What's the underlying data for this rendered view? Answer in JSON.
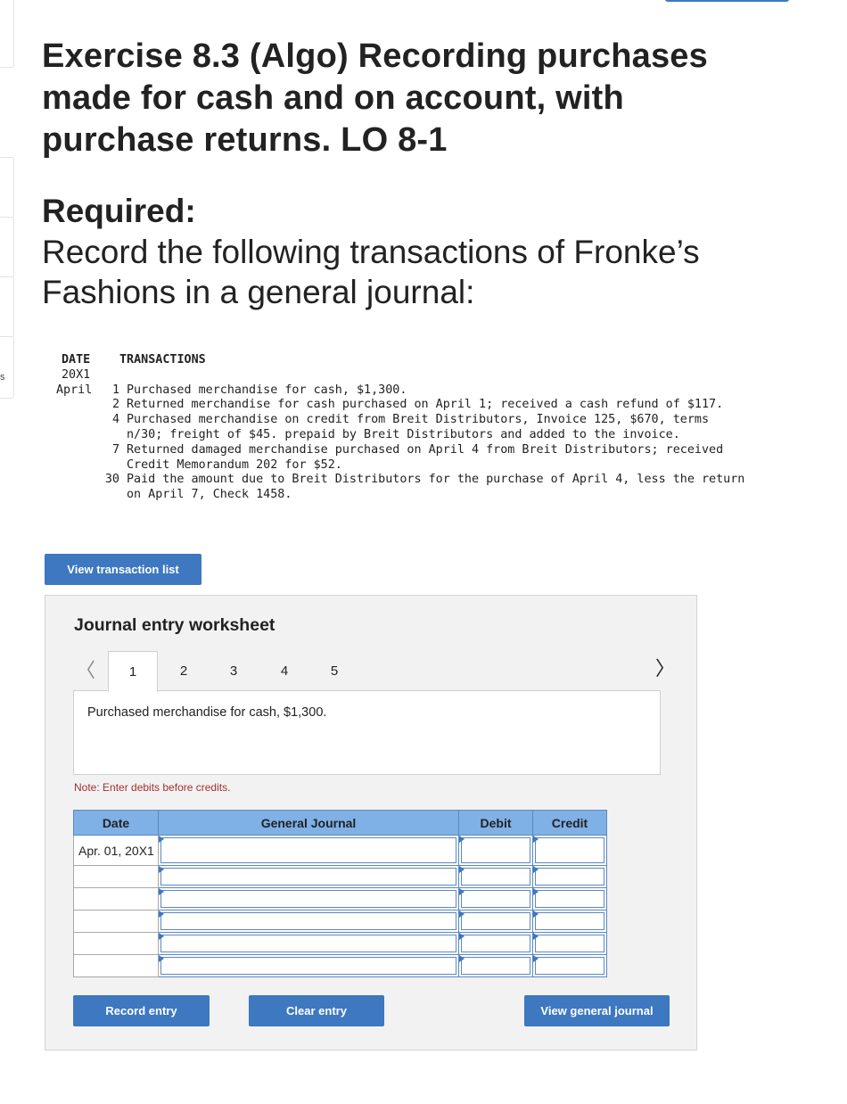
{
  "side_letter": "s",
  "title": "Exercise 8.3 (Algo) Recording purchases made for cash and on account, with purchase returns. LO 8-1",
  "required_label": "Required:",
  "instruction": "Record the following transactions of Fronke’s Fashions in a general journal:",
  "transactions": {
    "header_date": "DATE",
    "header_transactions": "TRANSACTIONS",
    "year": "20X1",
    "lines": [
      {
        "month": "April",
        "day": "1",
        "text": "Purchased merchandise for cash, $1,300."
      },
      {
        "month": "",
        "day": "2",
        "text": "Returned merchandise for cash purchased on April 1; received a cash refund of $117."
      },
      {
        "month": "",
        "day": "4",
        "text": "Purchased merchandise on credit from Breit Distributors, Invoice 125, $670, terms"
      },
      {
        "month": "",
        "day": "",
        "text": "n/30; freight of $45. prepaid by Breit Distributors and added to the invoice."
      },
      {
        "month": "",
        "day": "7",
        "text": "Returned damaged merchandise purchased on April 4 from Breit Distributors; received"
      },
      {
        "month": "",
        "day": "",
        "text": "Credit Memorandum 202 for $52."
      },
      {
        "month": "",
        "day": "30",
        "text": "Paid the amount due to Breit Distributors for the purchase of April 4, less the return"
      },
      {
        "month": "",
        "day": "",
        "text": "on April 7, Check 1458."
      }
    ]
  },
  "view_transaction_list_label": "View transaction list",
  "worksheet": {
    "title": "Journal entry worksheet",
    "prev_icon": "chevron-left-icon",
    "next_icon": "chevron-right-icon",
    "tabs": [
      "1",
      "2",
      "3",
      "4",
      "5"
    ],
    "active_tab": "1",
    "description": "Purchased merchandise for cash, $1,300.",
    "note": "Note: Enter debits before credits.",
    "table": {
      "headers": {
        "date": "Date",
        "journal": "General Journal",
        "debit": "Debit",
        "credit": "Credit"
      },
      "first_date": "Apr. 01, 20X1"
    },
    "record_label": "Record entry",
    "clear_label": "Clear entry",
    "view_gj_label": "View general journal"
  },
  "colors": {
    "button_blue": "#3d78c0",
    "table_header_blue": "#7fb0e6",
    "note_red": "#a33030"
  }
}
